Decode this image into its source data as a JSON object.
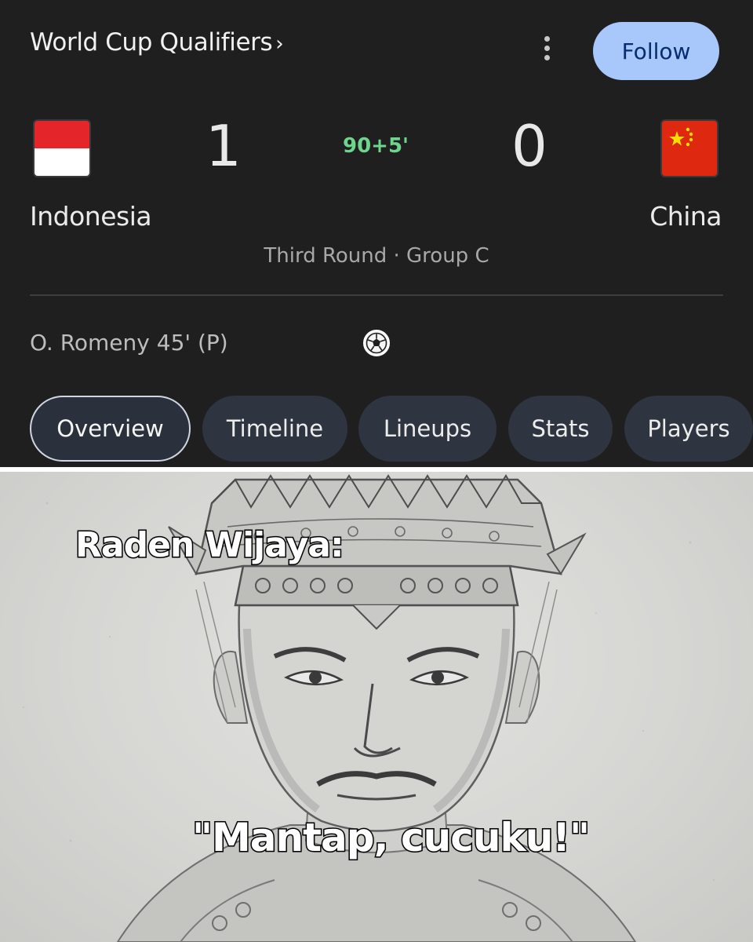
{
  "match": {
    "competition": "World Cup Qualifiers",
    "follow_label": "Follow",
    "home": {
      "name": "Indonesia",
      "score": "1",
      "flag_icon": "indonesia-flag-icon"
    },
    "away": {
      "name": "China",
      "score": "0",
      "flag_icon": "china-flag-icon"
    },
    "clock": "90+5'",
    "stage": "Third Round · Group C",
    "scorers": [
      {
        "text": "O. Romeny 45' (P)"
      }
    ],
    "tabs": [
      {
        "label": "Overview",
        "active": true
      },
      {
        "label": "Timeline",
        "active": false
      },
      {
        "label": "Lineups",
        "active": false
      },
      {
        "label": "Stats",
        "active": false
      },
      {
        "label": "Players",
        "active": false
      }
    ]
  },
  "meme": {
    "caption_top": "Raden Wijaya:",
    "caption_bottom": "\"Mantap, cucuku!\""
  },
  "colors": {
    "card_background": "#1f1f1f",
    "follow_button": "#a8c7fa",
    "live_clock": "#6dd58c",
    "tab_background": "#2e3440"
  }
}
